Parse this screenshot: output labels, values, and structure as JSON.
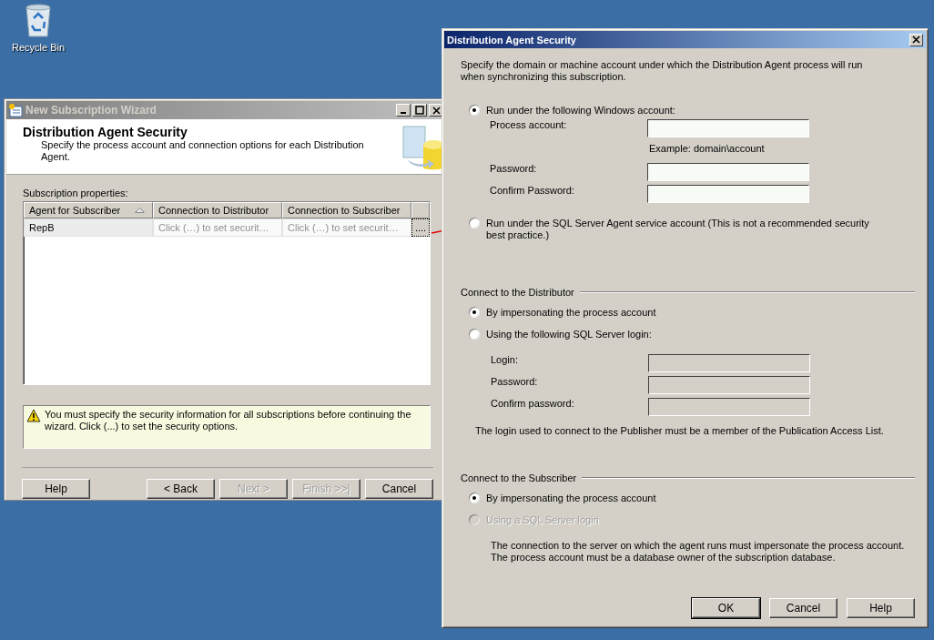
{
  "desktop": {
    "icons": [
      {
        "label": "Recycle Bin"
      }
    ]
  },
  "wizard": {
    "title": "New Subscription Wizard",
    "heading": "Distribution Agent Security",
    "subheading": "Specify the process account and connection options for each Distribution Agent.",
    "grid_label": "Subscription properties:",
    "columns": [
      {
        "label": "Agent for Subscriber",
        "sorted": true
      },
      {
        "label": "Connection to Distributor",
        "sorted": false
      },
      {
        "label": "Connection to Subscriber",
        "sorted": false
      }
    ],
    "rows": [
      {
        "cells": [
          {
            "text": "RepB",
            "dimmed": false
          },
          {
            "text": "Click (…) to set securit…",
            "dimmed": true
          },
          {
            "text": "Click (…) to set securit…",
            "dimmed": true
          }
        ],
        "button": "...."
      }
    ],
    "warning": "You must specify the security information for all subscriptions before continuing the wizard. Click (...) to set the security options.",
    "buttons": [
      {
        "label": "Help",
        "disabled": false
      },
      {
        "label": "< Back",
        "disabled": false
      },
      {
        "label": "Next >",
        "disabled": true
      },
      {
        "label": "Finish >>|",
        "disabled": true
      },
      {
        "label": "Cancel",
        "disabled": false
      }
    ]
  },
  "dialog": {
    "title": "Distribution Agent Security",
    "intro": "Specify the domain or machine account under which the Distribution Agent process will run when synchronizing this subscription.",
    "account_options": [
      {
        "label": "Run under the following Windows account:",
        "selected": true
      },
      {
        "label": "Run under the SQL Server Agent service account (This is not a recommended security best practice.)",
        "selected": false
      }
    ],
    "account_fields": [
      {
        "label": "Process account:",
        "hint": "Example: domain\\account",
        "disabled": false
      },
      {
        "label": "Password:",
        "disabled": false
      },
      {
        "label": "Confirm Password:",
        "disabled": false
      }
    ],
    "distributor": {
      "title": "Connect to the Distributor",
      "options": [
        {
          "label": "By impersonating the process account",
          "selected": true,
          "disabled": false
        },
        {
          "label": "Using the following SQL Server login:",
          "selected": false,
          "disabled": false
        }
      ],
      "fields": [
        {
          "label": "Login:",
          "disabled": true
        },
        {
          "label": "Password:",
          "disabled": true
        },
        {
          "label": "Confirm password:",
          "disabled": true
        }
      ],
      "note": "The login used to connect to the Publisher must be a member of the Publication Access List."
    },
    "subscriber": {
      "title": "Connect to the Subscriber",
      "options": [
        {
          "label": "By impersonating the process account",
          "selected": true,
          "disabled": false
        },
        {
          "label": "Using a SQL Server login",
          "selected": false,
          "disabled": true
        }
      ],
      "note_lines": [
        "The connection to the server on which the agent runs must impersonate the process account.",
        "The process account must be a database owner of the subscription database."
      ]
    },
    "buttons": [
      {
        "label": "OK",
        "default": true
      },
      {
        "label": "Cancel",
        "default": false
      },
      {
        "label": "Help",
        "default": false
      }
    ]
  }
}
